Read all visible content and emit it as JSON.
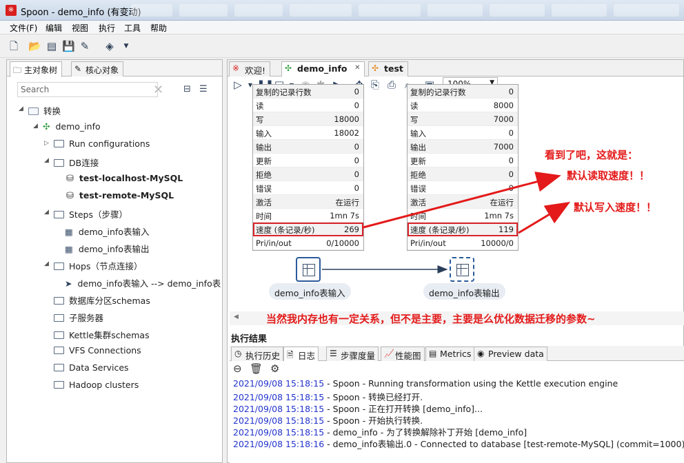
{
  "window": {
    "title": "Spoon - demo_info (有变动)",
    "app_icon": "spoon-icon"
  },
  "menu": [
    "文件(F)",
    "编辑",
    "视图",
    "执行",
    "工具",
    "帮助"
  ],
  "left_tabs": [
    {
      "label": "主对象树",
      "icon": "folder-tree-icon"
    },
    {
      "label": "核心对象",
      "icon": "pencil-icon"
    }
  ],
  "search": {
    "placeholder": "Search"
  },
  "tree": [
    {
      "label": "转换",
      "depth": 0,
      "expanded": true,
      "icon": "folder-icon"
    },
    {
      "label": "demo_info",
      "depth": 1,
      "expanded": true,
      "icon": "transformation-icon"
    },
    {
      "label": "Run configurations",
      "depth": 2,
      "expanded": false,
      "icon": "folder-icon"
    },
    {
      "label": "DB连接",
      "depth": 2,
      "expanded": true,
      "icon": "folder-icon"
    },
    {
      "label": "test-localhost-MySQL",
      "depth": 3,
      "icon": "database-icon",
      "bold": true
    },
    {
      "label": "test-remote-MySQL",
      "depth": 3,
      "icon": "database-icon",
      "bold": true
    },
    {
      "label": "Steps（步骤）",
      "depth": 2,
      "expanded": true,
      "icon": "folder-icon"
    },
    {
      "label": "demo_info表输入",
      "depth": 3,
      "icon": "table-input-icon"
    },
    {
      "label": "demo_info表输出",
      "depth": 3,
      "icon": "table-output-icon"
    },
    {
      "label": "Hops（节点连接）",
      "depth": 2,
      "expanded": true,
      "icon": "folder-icon"
    },
    {
      "label": "demo_info表输入 --> demo_info表输",
      "depth": 3,
      "icon": "hop-arrow-icon"
    },
    {
      "label": "数据库分区schemas",
      "depth": 1,
      "icon": "folder-icon"
    },
    {
      "label": "子服务器",
      "depth": 1,
      "icon": "folder-icon"
    },
    {
      "label": "Kettle集群schemas",
      "depth": 1,
      "icon": "folder-icon"
    },
    {
      "label": "VFS Connections",
      "depth": 1,
      "icon": "folder-icon"
    },
    {
      "label": "Data Services",
      "depth": 1,
      "icon": "folder-icon"
    },
    {
      "label": "Hadoop clusters",
      "depth": 1,
      "icon": "folder-icon"
    }
  ],
  "editor_tabs": [
    {
      "label": "欢迎!",
      "icon": "spoon-icon",
      "active": false
    },
    {
      "label": "demo_info",
      "icon": "transformation-icon",
      "active": true,
      "close": "✕"
    },
    {
      "label": "test",
      "icon": "transformation-icon",
      "active": false
    }
  ],
  "zoom": "100%",
  "step_input_stats": [
    [
      "复制的记录行数",
      "0"
    ],
    [
      "读",
      "0"
    ],
    [
      "写",
      "18000"
    ],
    [
      "输入",
      "18002"
    ],
    [
      "输出",
      "0"
    ],
    [
      "更新",
      "0"
    ],
    [
      "拒绝",
      "0"
    ],
    [
      "错误",
      "0"
    ],
    [
      "激活",
      "在运行"
    ],
    [
      "时间",
      "1mn 7s"
    ],
    [
      "速度 (条记录/秒)",
      "269"
    ],
    [
      "Pri/in/out",
      "0/10000"
    ]
  ],
  "step_output_stats": [
    [
      "复制的记录行数",
      "0"
    ],
    [
      "读",
      "8000"
    ],
    [
      "写",
      "7000"
    ],
    [
      "输入",
      "0"
    ],
    [
      "输出",
      "7000"
    ],
    [
      "更新",
      "0"
    ],
    [
      "拒绝",
      "0"
    ],
    [
      "错误",
      "0"
    ],
    [
      "激活",
      "在运行"
    ],
    [
      "时间",
      "1mn 7s"
    ],
    [
      "速度 (条记录/秒)",
      "119"
    ],
    [
      "Pri/in/out",
      "10000/0"
    ]
  ],
  "steps": {
    "input_label": "demo_info表输入",
    "output_label": "demo_info表输出"
  },
  "annotations": {
    "line1": "看到了吧，这就是：",
    "line2": "默认读取速度！！",
    "line3": "默认写入速度！！",
    "bottom": "当然我内存也有一定关系，但不是主要，主要是么优化数据迁移的参数~",
    "color": "#e41a1a"
  },
  "results": {
    "title": "执行结果",
    "tabs": [
      {
        "label": "执行历史",
        "icon": "history-icon"
      },
      {
        "label": "日志",
        "icon": "log-icon",
        "active": true
      },
      {
        "label": "步骤度量",
        "icon": "step-metrics-icon"
      },
      {
        "label": "性能图",
        "icon": "chart-icon"
      },
      {
        "label": "Metrics",
        "icon": "metrics-icon"
      },
      {
        "label": "Preview data",
        "icon": "eye-icon"
      }
    ],
    "log": [
      {
        "ts": "2021/09/08 15:18:15",
        "msg": " - Spoon - Running transformation using the Kettle execution engine"
      },
      {
        "ts": "2021/09/08 15:18:15",
        "msg": " - Spoon - 转换已经打开."
      },
      {
        "ts": "2021/09/08 15:18:15",
        "msg": " - Spoon - 正在打开转换 [demo_info]..."
      },
      {
        "ts": "2021/09/08 15:18:15",
        "msg": " - Spoon - 开始执行转换."
      },
      {
        "ts": "2021/09/08 15:18:15",
        "msg": " - demo_info - 为了转换解除补丁开始  [demo_info]"
      },
      {
        "ts": "2021/09/08 15:18:16",
        "msg": " - demo_info表输出.0 - Connected to database [test-remote-MySQL] (commit=1000)"
      }
    ]
  }
}
